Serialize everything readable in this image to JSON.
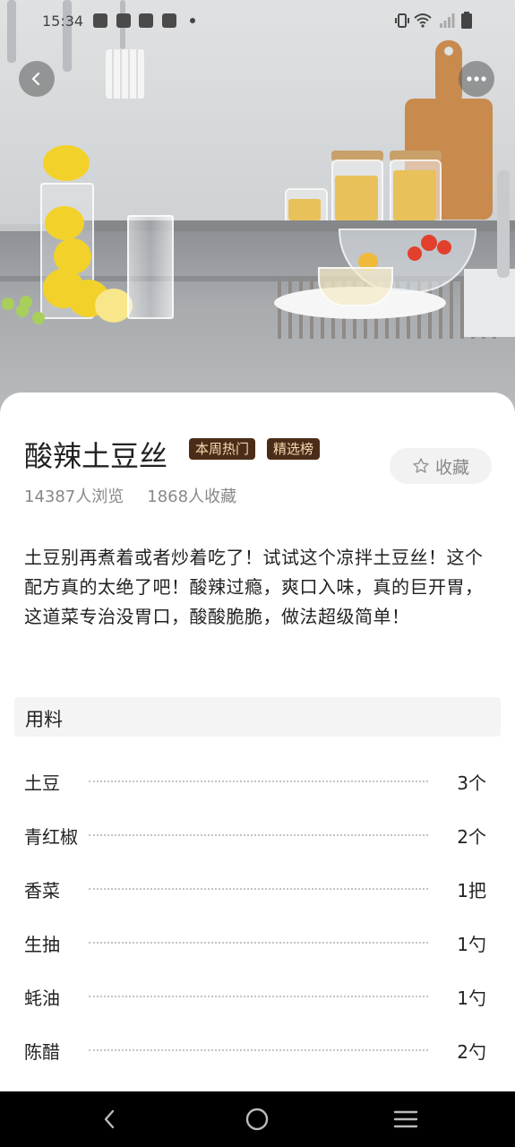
{
  "status_bar": {
    "time": "15:34"
  },
  "hero": {
    "back_icon": "chevron-left-icon",
    "more_icon": "more-horizontal-icon"
  },
  "recipe": {
    "title": "酸辣土豆丝",
    "tags": [
      "本周热门",
      "精选榜"
    ],
    "favorite_label": "收藏",
    "views": "14387人浏览",
    "favorites": "1868人收藏",
    "description": "土豆别再煮着或者炒着吃了！试试这个凉拌土豆丝！这个配方真的太绝了吧！酸辣过瘾，爽口入味，真的巨开胃，这道菜专治没胃口，酸酸脆脆，做法超级简单！"
  },
  "ingredients": {
    "section_title": "用料",
    "items": [
      {
        "name": "土豆",
        "amount": "3个"
      },
      {
        "name": "青红椒",
        "amount": "2个"
      },
      {
        "name": "香菜",
        "amount": "1把"
      },
      {
        "name": "生抽",
        "amount": "1勺"
      },
      {
        "name": "蚝油",
        "amount": "1勺"
      },
      {
        "name": "陈醋",
        "amount": "2勺"
      }
    ]
  },
  "colors": {
    "tag_bg": "#4a2d18",
    "tag_text": "#f3dcb0",
    "nav_bg": "#000000"
  }
}
